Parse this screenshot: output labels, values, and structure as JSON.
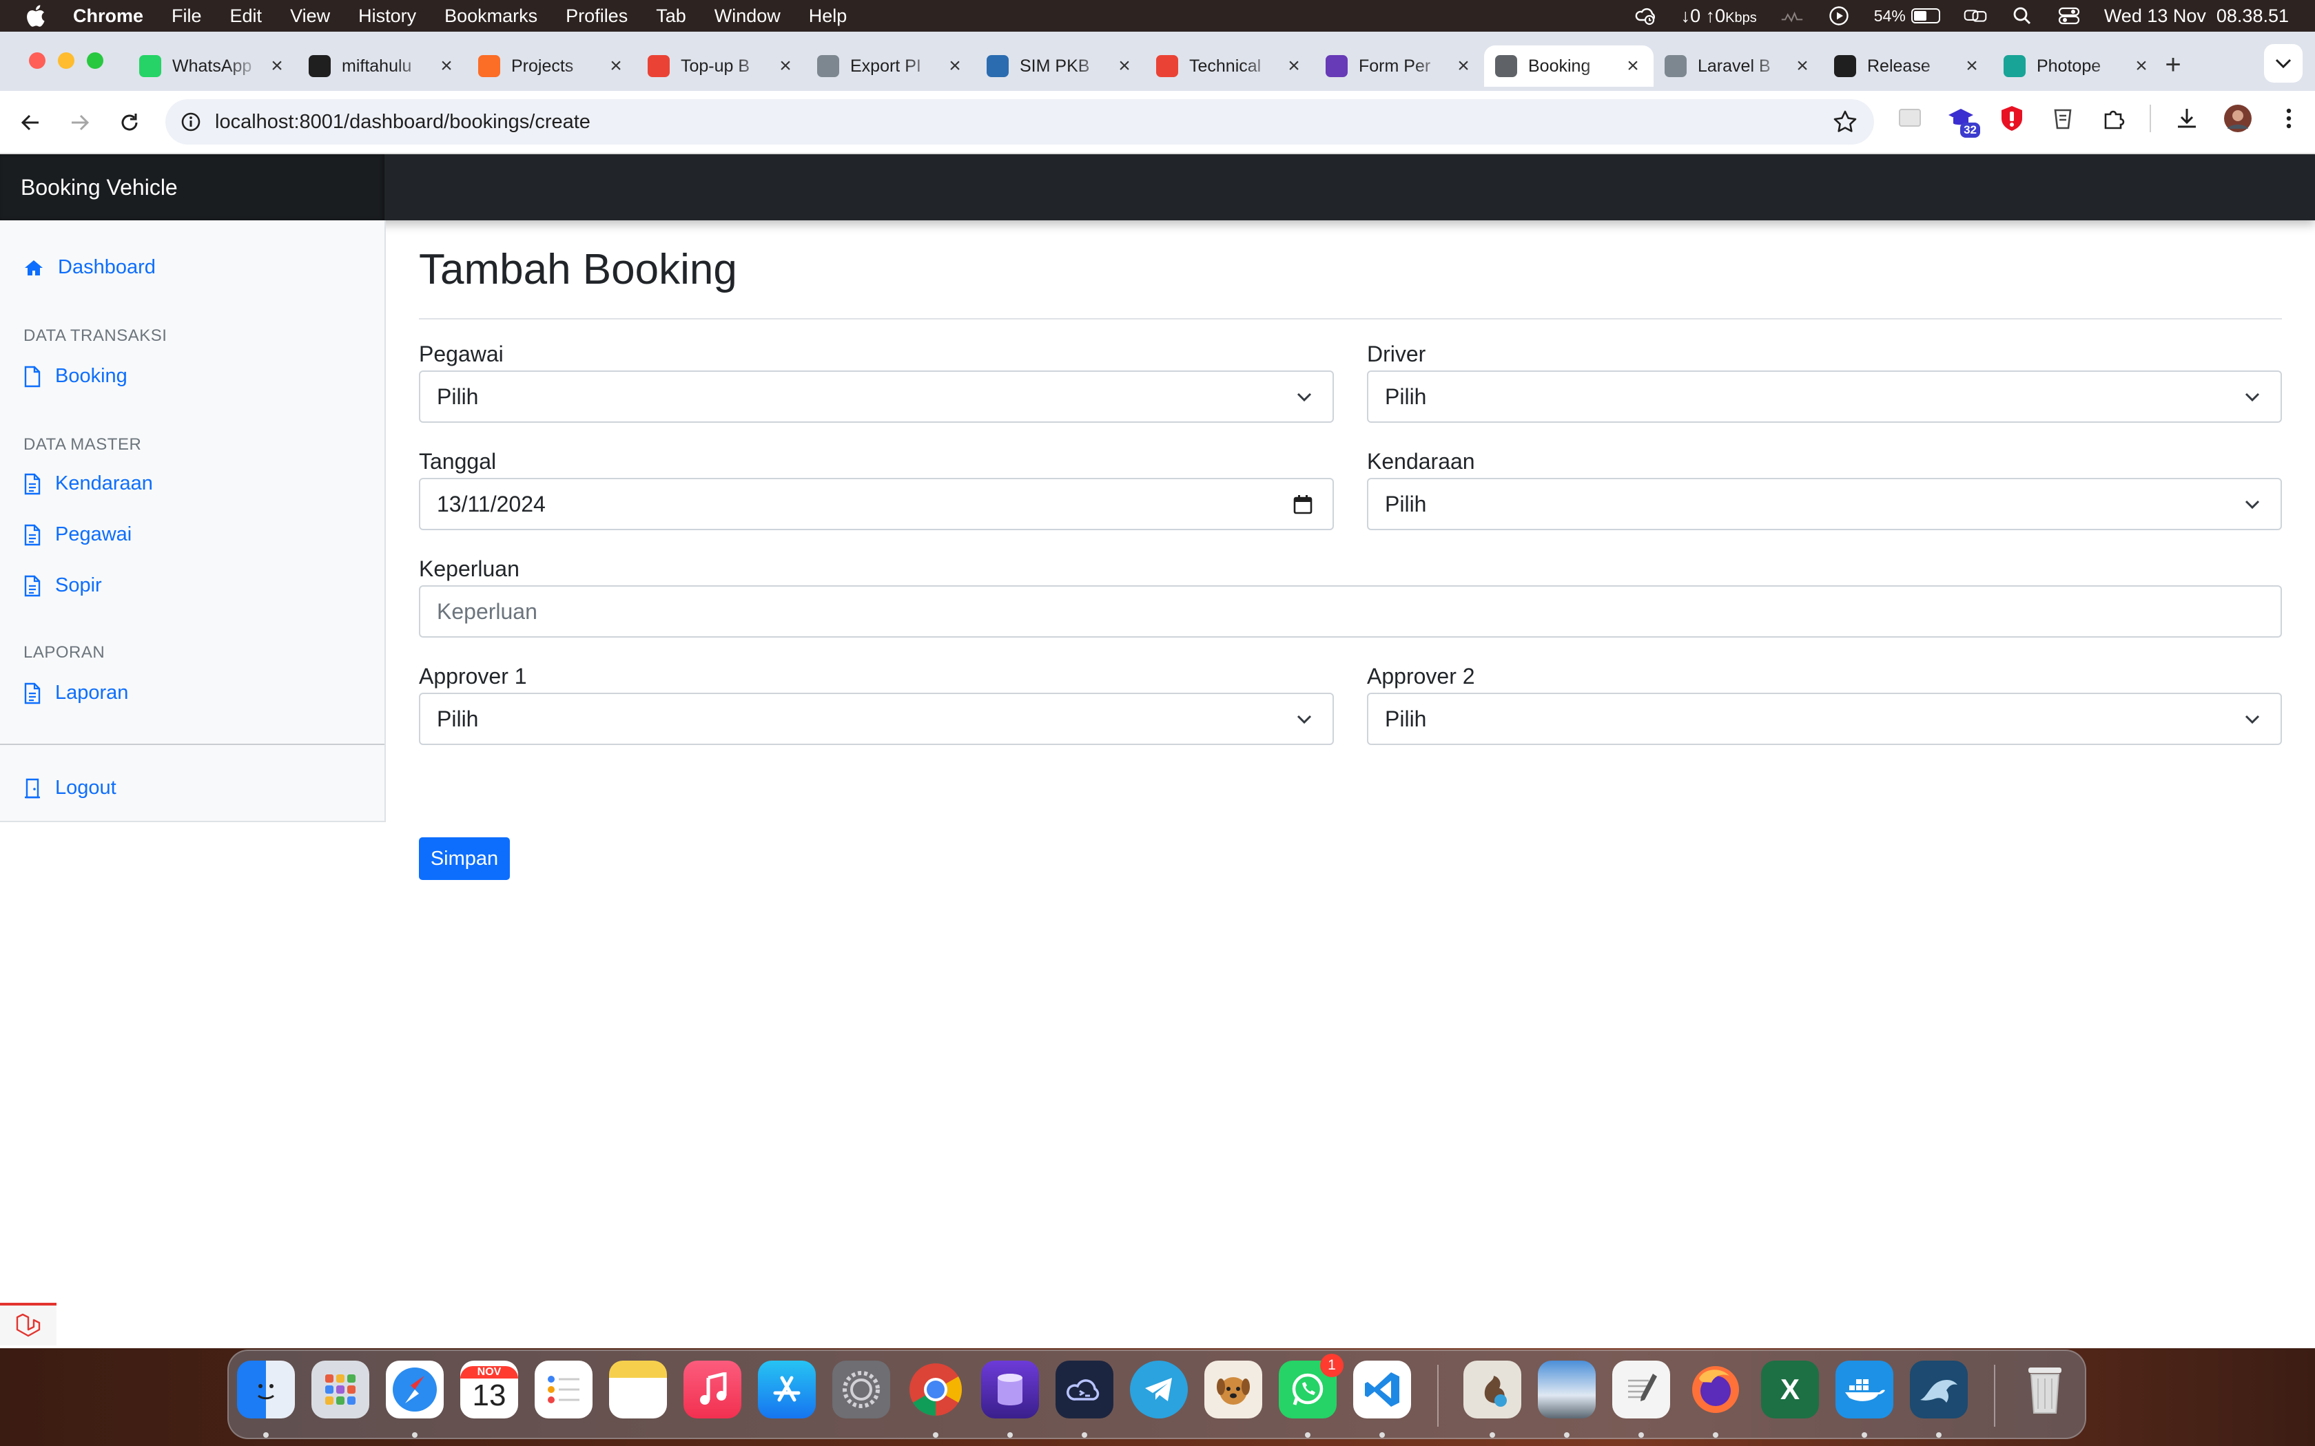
{
  "menubar": {
    "app_name": "Chrome",
    "items": [
      "File",
      "Edit",
      "View",
      "History",
      "Bookmarks",
      "Profiles",
      "Tab",
      "Window",
      "Help"
    ],
    "network": "↓0 ↑0",
    "network_unit": "Kbps",
    "battery_percent": "54%",
    "battery_level": 0.54,
    "clock": "Wed 13 Nov  08.38.51"
  },
  "browser": {
    "tabs": [
      {
        "title": "WhatsApp",
        "favicon": "whatsapp-icon",
        "color": "#25d366"
      },
      {
        "title": "miftahulu",
        "favicon": "github-icon",
        "color": "#1f1f1f"
      },
      {
        "title": "Projects",
        "favicon": "gitlab-icon",
        "color": "#fc6d26"
      },
      {
        "title": "Top-up B",
        "favicon": "gmail-icon",
        "color": "#ea4335"
      },
      {
        "title": "Export PI",
        "favicon": "cube-icon",
        "color": "#7d8790"
      },
      {
        "title": "SIM PKB",
        "favicon": "seal-icon",
        "color": "#2b6cb0"
      },
      {
        "title": "Technical",
        "favicon": "gmail-icon",
        "color": "#ea4335"
      },
      {
        "title": "Form Per",
        "favicon": "forms-icon",
        "color": "#673ab7"
      },
      {
        "title": "Booking",
        "favicon": "globe-icon",
        "color": "#5f6368",
        "active": true
      },
      {
        "title": "Laravel B",
        "favicon": "cube-icon",
        "color": "#7d8790"
      },
      {
        "title": "Release",
        "favicon": "github-icon",
        "color": "#1f1f1f"
      },
      {
        "title": "Photope",
        "favicon": "photopea-icon",
        "color": "#18a497"
      }
    ],
    "url": "localhost:8001/dashboard/bookings/create",
    "extension_badge": "32"
  },
  "app": {
    "brand": "Booking Vehicle",
    "sidebar": {
      "dashboard": "Dashboard",
      "section_transaksi": "DATA TRANSAKSI",
      "booking": "Booking",
      "section_master": "DATA MASTER",
      "kendaraan": "Kendaraan",
      "pegawai": "Pegawai",
      "sopir": "Sopir",
      "section_laporan": "LAPORAN",
      "laporan": "Laporan",
      "logout": "Logout"
    },
    "form": {
      "title": "Tambah Booking",
      "pegawai_label": "Pegawai",
      "pegawai_value": "Pilih",
      "driver_label": "Driver",
      "driver_value": "Pilih",
      "tanggal_label": "Tanggal",
      "tanggal_value": "13/11/2024",
      "kendaraan_label": "Kendaraan",
      "kendaraan_value": "Pilih",
      "keperluan_label": "Keperluan",
      "keperluan_placeholder": "Keperluan",
      "approver1_label": "Approver 1",
      "approver1_value": "Pilih",
      "approver2_label": "Approver 2",
      "approver2_value": "Pilih",
      "submit": "Simpan"
    }
  },
  "dock": {
    "calendar_month": "NOV",
    "calendar_day": "13",
    "whatsapp_badge": "1",
    "excel_letter": "X"
  },
  "colors": {
    "primary": "#0d6efd",
    "navbar": "#212529"
  }
}
